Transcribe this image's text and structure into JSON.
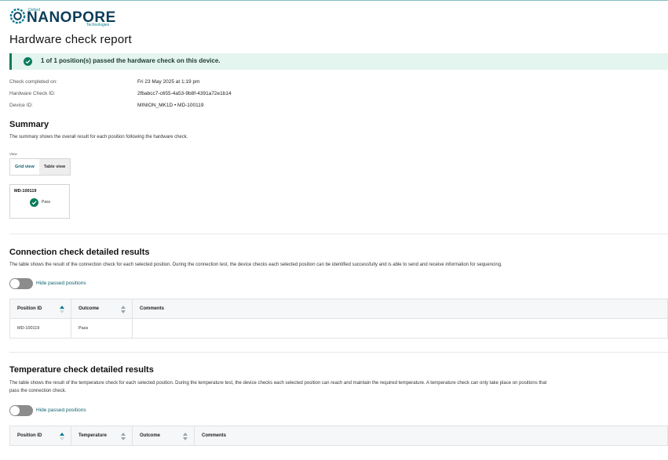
{
  "brand": {
    "oxford": "Oxford",
    "nanopore": "NANOPORE",
    "technologies": "Technologies",
    "accent": "#0a7c92",
    "navy": "#0c3d5a"
  },
  "page_title": "Hardware check report",
  "banner": {
    "icon": "check-circle-icon",
    "text": "1 of 1 position(s) passed the hardware check on this device.",
    "color": "#0a7c5e"
  },
  "meta": [
    {
      "label": "Check completed on:",
      "value": "Fri 23 May 2025 at 1:19 pm"
    },
    {
      "label": "Hardware Check ID:",
      "value": "2fbabcc7-c655-4a53-9b8f-4391a72e1b14"
    },
    {
      "label": "Device ID:",
      "value": "MINION_MK1D • MD-100119"
    }
  ],
  "summary": {
    "title": "Summary",
    "description": "The summary shows the overall result for each position following the hardware check.",
    "view_label": "View",
    "views": [
      "Grid view",
      "Table view"
    ],
    "active_view": "Grid view",
    "card": {
      "position": "MD-100119",
      "status": "Pass",
      "icon": "check-circle-icon"
    }
  },
  "connection": {
    "title": "Connection check detailed results",
    "description": "The table shows the result of the connection check for each selected position. During the connection test, the device checks each selected position can be identified successfully and is able to send and receive information for sequencing.",
    "toggle_label": "Hide passed positions",
    "toggle_on": false,
    "columns": [
      "Position ID",
      "Outcome",
      "Comments"
    ],
    "rows": [
      [
        "MD-100119",
        "Pass",
        ""
      ]
    ]
  },
  "temperature": {
    "title": "Temperature check detailed results",
    "description_line1": "The table shows the result of the temperature check for each selected position. During the temperature test, the device checks each selected position can reach and maintain the required temperature. A temperature check can only take place on positions that",
    "description_line2": "pass the connection check.",
    "toggle_label": "Hide passed positions",
    "toggle_on": false,
    "columns": [
      "Position ID",
      "Temperature",
      "Outcome",
      "Comments"
    ]
  }
}
